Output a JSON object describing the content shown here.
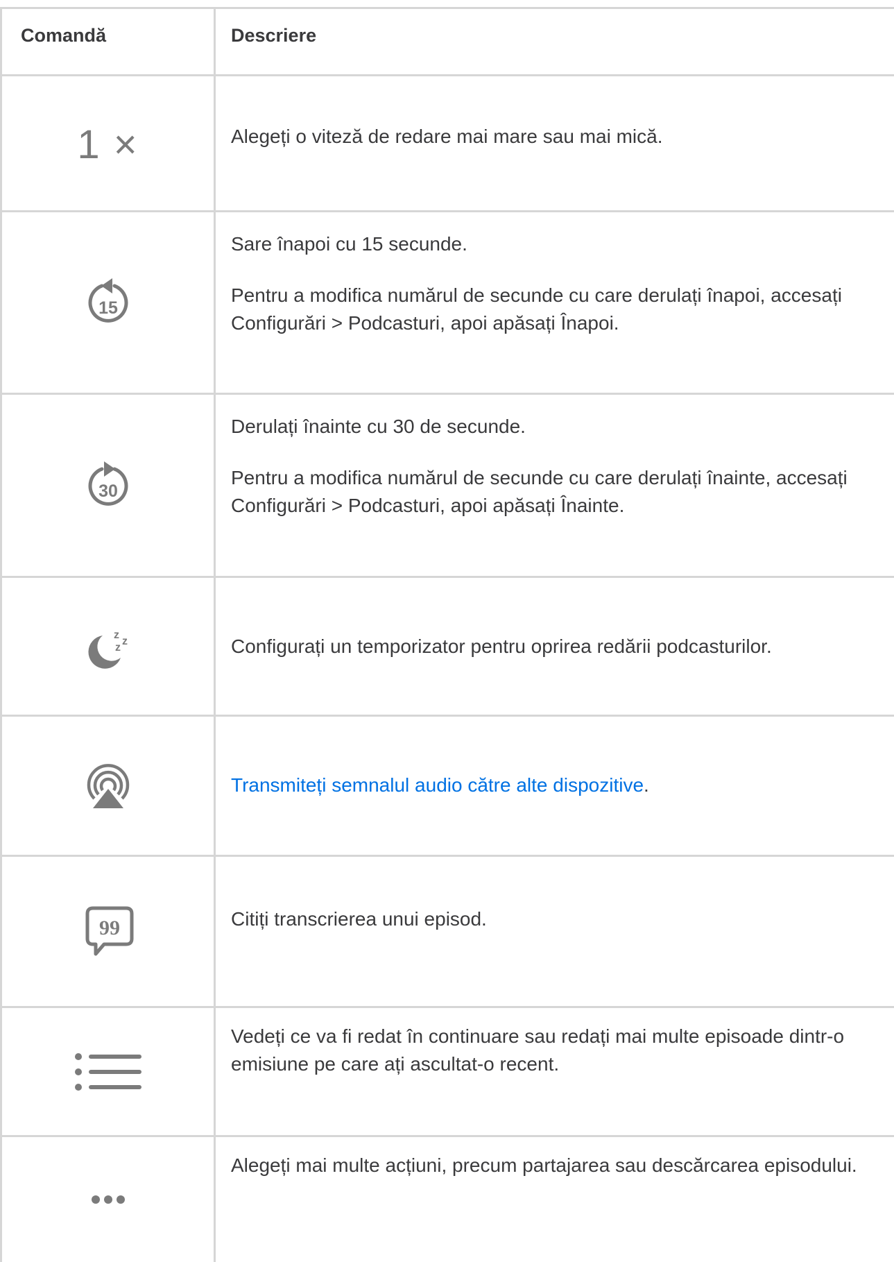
{
  "table": {
    "headers": {
      "command": "Comandă",
      "description": "Descriere"
    },
    "rows": [
      {
        "icon": "playback-speed-icon",
        "icon_text": "1 ×",
        "paragraphs": [
          "Alegeți o viteză de redare mai mare sau mai mică."
        ]
      },
      {
        "icon": "skip-back-15-icon",
        "icon_text": "15",
        "paragraphs": [
          "Sare înapoi cu 15 secunde.",
          "Pentru a modifica numărul de secunde cu care derulați înapoi, accesați Configurări > Podcasturi, apoi apăsați Înapoi."
        ]
      },
      {
        "icon": "skip-forward-30-icon",
        "icon_text": "30",
        "paragraphs": [
          "Derulați înainte cu 30 de secunde.",
          "Pentru a modifica numărul de secunde cu care derulați înainte, accesați Configurări > Podcasturi, apoi apăsați Înainte."
        ]
      },
      {
        "icon": "sleep-timer-icon",
        "icon_text": "z z z",
        "paragraphs": [
          "Configurați un temporizator pentru oprirea redării podcasturilor."
        ]
      },
      {
        "icon": "airplay-icon",
        "link_text": "Transmiteți semnalul audio către alte dispozitive",
        "trailing": "."
      },
      {
        "icon": "transcript-icon",
        "icon_text": "99",
        "paragraphs": [
          "Citiți transcrierea unui episod."
        ]
      },
      {
        "icon": "up-next-list-icon",
        "paragraphs": [
          "Vedeți ce va fi redat în continuare sau redați mai multe episoade dintr-o emisiune pe care ați ascultat-o recent."
        ]
      },
      {
        "icon": "more-options-icon",
        "paragraphs": [
          "Alegeți mai multe acțiuni, precum partajarea sau descărcarea episodului."
        ]
      }
    ]
  },
  "colors": {
    "icon": "#7b7b7b",
    "text": "#3a3a3c",
    "link": "#0071e3",
    "grid": "#d6d6d6"
  }
}
